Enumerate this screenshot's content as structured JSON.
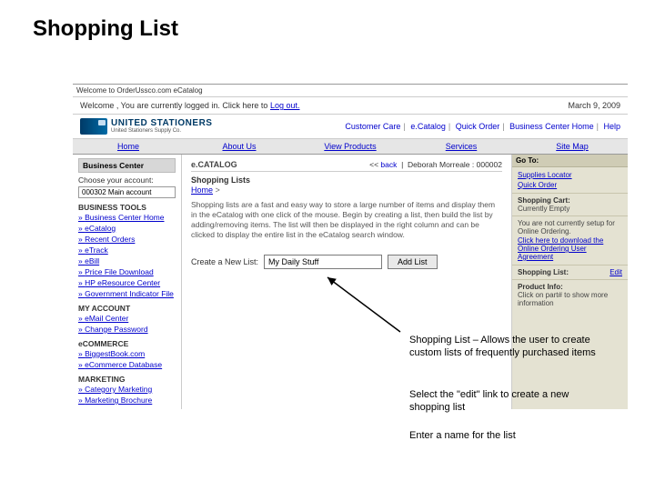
{
  "slide": {
    "title": "Shopping List"
  },
  "browser": {
    "url_hint": "Welcome to OrderUssco.com eCatalog"
  },
  "header": {
    "welcome_prefix": "Welcome ,   You are currently logged in.  Click here to ",
    "logout": "Log out.",
    "date": "March 9, 2009",
    "brand_name": "UNITED STATIONERS",
    "brand_sub": "United Stationers Supply Co.",
    "topnav": [
      "Customer Care",
      "e.Catalog",
      "Quick Order",
      "Business Center Home",
      "Help"
    ]
  },
  "mainnav": [
    "Home",
    "About Us",
    "View Products",
    "Services",
    "Site Map"
  ],
  "sidebar": {
    "panel": "Business Center",
    "choose": "Choose your account:",
    "account": "000302 Main account",
    "s1": "BUSINESS TOOLS",
    "s1_links": [
      "Business Center Home",
      "eCatalog",
      "Recent Orders",
      "eTrack",
      "eBill",
      "Price File Download",
      "HP eResource Center",
      "Government Indicator File"
    ],
    "s2": "MY ACCOUNT",
    "s2_links": [
      "eMail Center",
      "Change Password"
    ],
    "s3": "eCOMMERCE",
    "s3_links": [
      "BiggestBook.com",
      "eCommerce Database"
    ],
    "s4": "MARKETING",
    "s4_links": [
      "Category Marketing",
      "Marketing Brochure"
    ]
  },
  "center": {
    "ecatalog": "e.CATALOG",
    "back": "back",
    "user": "Deborah Morreale : 000002",
    "list_heading": "Shopping Lists",
    "home_crumb": "Home",
    "crumb_arrow": ">",
    "body": "Shopping lists are a fast and easy way to store a large number of items and display them in the eCatalog with one click of the mouse. Begin by creating a list, then build the list by adding/removing items. The list will then be displayed in the right column and can be clicked to display the entire list in the eCatalog search window.",
    "create_label": "Create a New List:",
    "input_value": "My Daily Stuff",
    "add_btn": "Add List"
  },
  "right": {
    "goto": "Go To:",
    "links": [
      "Supplies Locator",
      "Quick Order"
    ],
    "cart_lbl": "Shopping Cart:",
    "cart_state": "Currently Empty",
    "setup_msg": "You are not currently setup for Online Ordering.",
    "dl_link": "Click here to download the Online Ordering User Agreement",
    "shoplist_lbl": "Shopping List:",
    "edit": "Edit",
    "prod_lbl": "Product Info:",
    "prod_hint": "Click on part# to show more information"
  },
  "annotations": {
    "a1": "Shopping List – Allows the user to create custom lists of frequently purchased items",
    "a2": "Select the \"edit\" link to create a new shopping list",
    "a3": "Enter a name for the list"
  }
}
